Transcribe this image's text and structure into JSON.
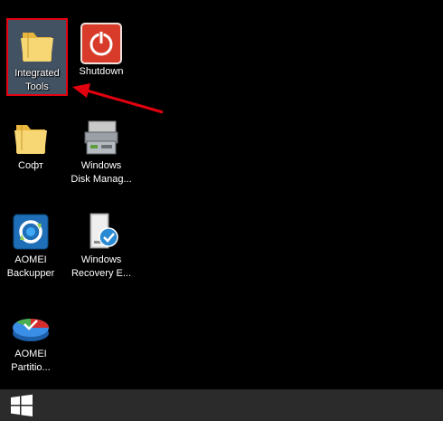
{
  "desktop": {
    "icons": [
      {
        "label": "Integrated\nTools",
        "icon": "folder-icon"
      },
      {
        "label": "Shutdown",
        "icon": "power-icon"
      },
      {
        "label": "Софт",
        "icon": "folder-icon"
      },
      {
        "label": "Windows\nDisk Manag...",
        "icon": "disk-management-icon"
      },
      {
        "label": "AOMEI\nBackupper",
        "icon": "backupper-icon"
      },
      {
        "label": "Windows\nRecovery E...",
        "icon": "recovery-environment-icon"
      },
      {
        "label": "AOMEI\nPartitio...",
        "icon": "partition-assistant-icon"
      }
    ],
    "selected_icon": "Integrated Tools",
    "selection_color": "#e3000f"
  },
  "annotation": {
    "arrow_color": "#e3000f",
    "icon": "red-arrow-icon"
  },
  "taskbar": {
    "background": "#2b2b2b",
    "start_icon": "windows-logo-icon"
  }
}
